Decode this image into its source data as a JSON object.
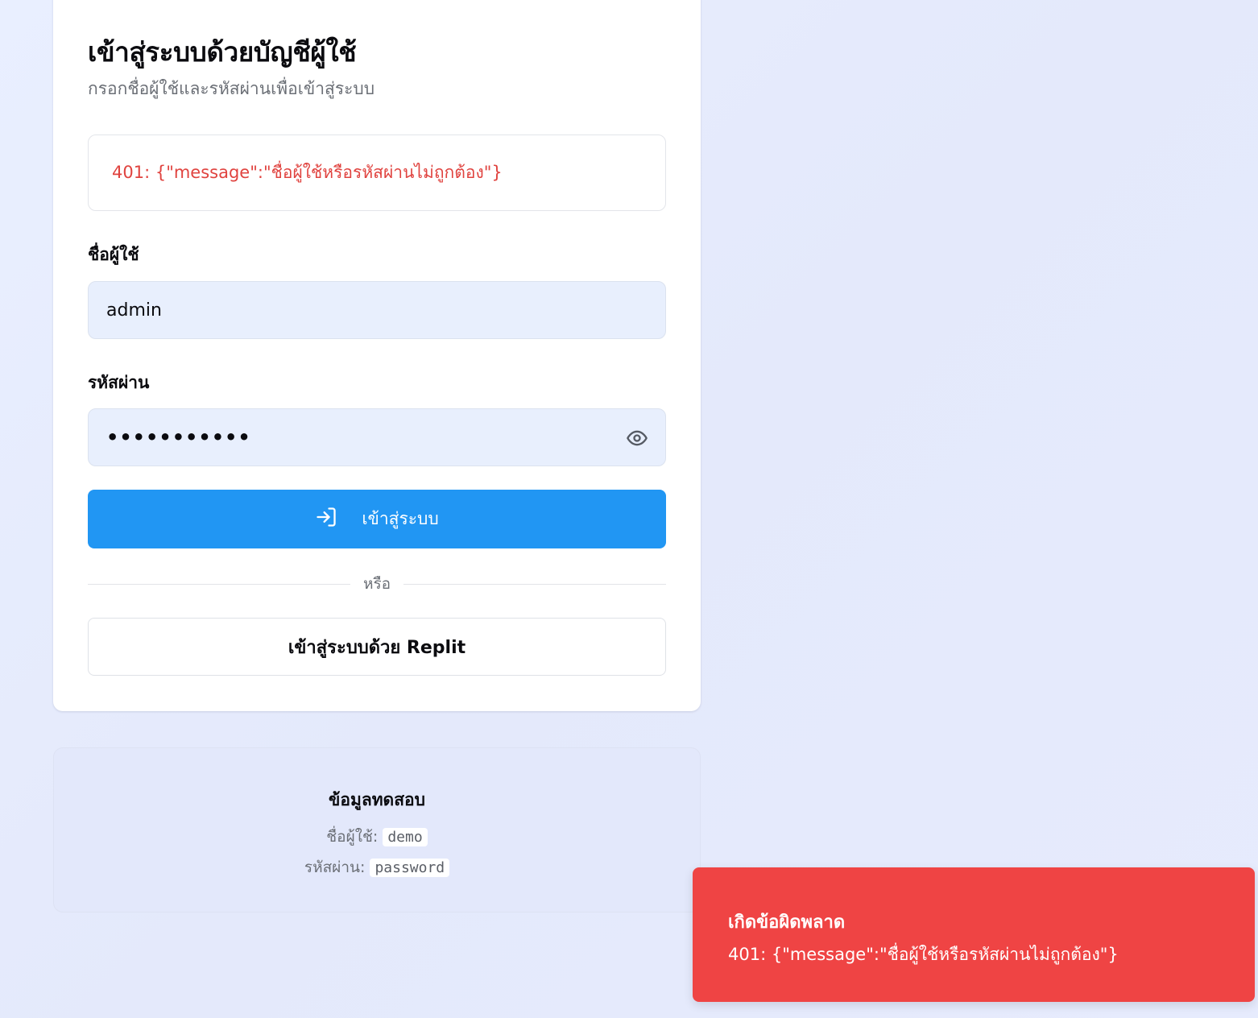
{
  "login": {
    "title": "เข้าสู่ระบบด้วยบัญชีผู้ใช้",
    "subtitle": "กรอกชื่อผู้ใช้และรหัสผ่านเพื่อเข้าสู่ระบบ",
    "error_message": "401: {\"message\":\"ชื่อผู้ใช้หรือรหัสผ่านไม่ถูกต้อง\"}",
    "username_label": "ชื่อผู้ใช้",
    "username_value": "admin",
    "password_label": "รหัสผ่าน",
    "password_value": "•••••••••••",
    "submit_label": "เข้าสู่ระบบ",
    "divider_text": "หรือ",
    "replit_label": "เข้าสู่ระบบด้วย Replit"
  },
  "test_info": {
    "title": "ข้อมูลทดสอบ",
    "username_label": "ชื่อผู้ใช้:",
    "username_value": "demo",
    "password_label": "รหัสผ่าน:",
    "password_value": "password"
  },
  "toast": {
    "title": "เกิดข้อผิดพลาด",
    "message": "401: {\"message\":\"ชื่อผู้ใช้หรือรหัสผ่านไม่ถูกต้อง\"}",
    "color": "#ef4444"
  },
  "icons": {
    "password_toggle": "eye-icon",
    "submit": "login-icon"
  },
  "colors": {
    "primary": "#2196f3",
    "error_text": "#e0433f",
    "input_bg": "#e8effd"
  }
}
